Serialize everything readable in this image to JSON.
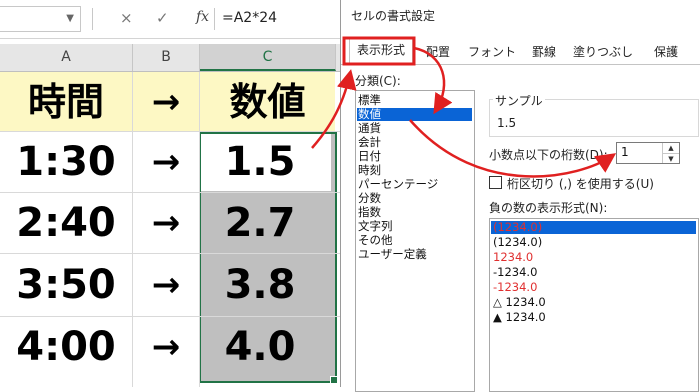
{
  "formula_bar": {
    "name_box": "",
    "cancel_icon": "×",
    "enter_icon": "✓",
    "fx_label": "fx",
    "formula": "=A2*24"
  },
  "sheet": {
    "columns": [
      "A",
      "B",
      "C"
    ],
    "selected_column": "C",
    "header_row": {
      "a": "時間",
      "b": "→",
      "c": "数値"
    },
    "rows": [
      {
        "a": "1:30",
        "b": "→",
        "c": "1.5"
      },
      {
        "a": "2:40",
        "b": "→",
        "c": "2.7"
      },
      {
        "a": "3:50",
        "b": "→",
        "c": "3.8"
      },
      {
        "a": "4:00",
        "b": "→",
        "c": "4.0"
      }
    ],
    "header_fill": "#fdf8c4",
    "selection_color": "#217346"
  },
  "dialog": {
    "title": "セルの書式設定",
    "tabs": [
      "表示形式",
      "配置",
      "フォント",
      "罫線",
      "塗りつぶし",
      "保護"
    ],
    "active_tab": "表示形式",
    "category_label": "分類(C):",
    "categories": [
      "標準",
      "数値",
      "通貨",
      "会計",
      "日付",
      "時刻",
      "パーセンテージ",
      "分数",
      "指数",
      "文字列",
      "その他",
      "ユーザー定義"
    ],
    "selected_category": "数値",
    "sample_label": "サンプル",
    "sample_value": "1.5",
    "decimal_label": "小数点以下の桁数(D):",
    "decimal_value": "1",
    "separator_label": "桁区切り (,) を使用する(U)",
    "negative_label": "負の数の表示形式(N):",
    "negative_formats": [
      {
        "text": "(1234.0)",
        "color": "#e03030"
      },
      {
        "text": "(1234.0)",
        "color": "#111111"
      },
      {
        "text": "1234.0",
        "color": "#e03030"
      },
      {
        "text": "-1234.0",
        "color": "#111111"
      },
      {
        "text": "-1234.0",
        "color": "#e03030"
      },
      {
        "text": "△ 1234.0",
        "color": "#111111"
      },
      {
        "text": "▲ 1234.0",
        "color": "#111111"
      }
    ],
    "accent_color": "#0a64d6"
  },
  "annotation_color": "#e02020"
}
